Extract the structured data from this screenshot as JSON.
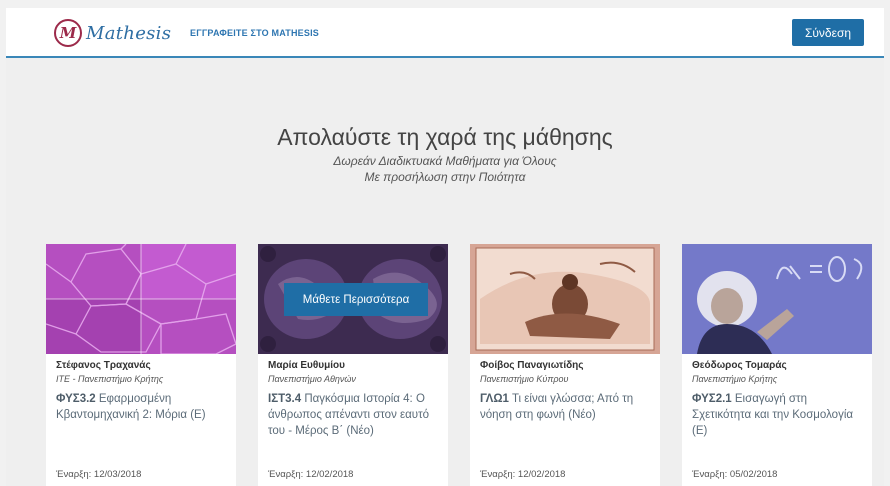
{
  "header": {
    "logo_mark": "M",
    "logo_text": "Mathesis",
    "nav_link": "ΕΓΓΡΑΦΕΙΤΕ ΣΤΟ MATHESIS",
    "login_label": "Σύνδεση"
  },
  "hero": {
    "title": "Απολαύστε τη χαρά της μάθησης",
    "subtitle1": "Δωρεάν Διαδικτυακά Μαθήματα για Όλους",
    "subtitle2": "Με προσήλωση στην Ποιότητα"
  },
  "courses": [
    {
      "instructor": "Στέφανος Τραχανάς",
      "institution": "ΙΤΕ - Πανεπιστήμιο Κρήτης",
      "code": "ΦΥΣ3.2",
      "title": "Εφαρμοσμένη Κβαντομηχανική 2: Μόρια (Ε)",
      "start": "Έναρξη: 12/03/2018"
    },
    {
      "instructor": "Μαρία Ευθυμίου",
      "institution": "Πανεπιστήμιο Αθηνών",
      "code": "ΙΣΤ3.4",
      "title": "Παγκόσμια Ιστορία 4: Ο άνθρωπος απέναντι στον εαυτό του - Μέρος Β΄ (Νέο)",
      "start": "Έναρξη: 12/02/2018",
      "button": "Μάθετε Περισσότερα"
    },
    {
      "instructor": "Φοίβος Παναγιωτίδης",
      "institution": "Πανεπιστήμιο Κύπρου",
      "code": "ΓΛΩ1",
      "title": "Τι είναι γλώσσα; Από τη νόηση στη φωνή (Νέο)",
      "start": "Έναρξη: 12/02/2018"
    },
    {
      "instructor": "Θεόδωρος Τομαράς",
      "institution": "Πανεπιστήμιο Κρήτης",
      "code": "ΦΥΣ2.1",
      "title": "Εισαγωγή στη Σχετικότητα και την Κοσμολογία (Ε)",
      "start": "Έναρξη: 05/02/2018"
    }
  ],
  "colors": {
    "accent": "#1f6ea6",
    "header_border": "#3a87b8"
  }
}
